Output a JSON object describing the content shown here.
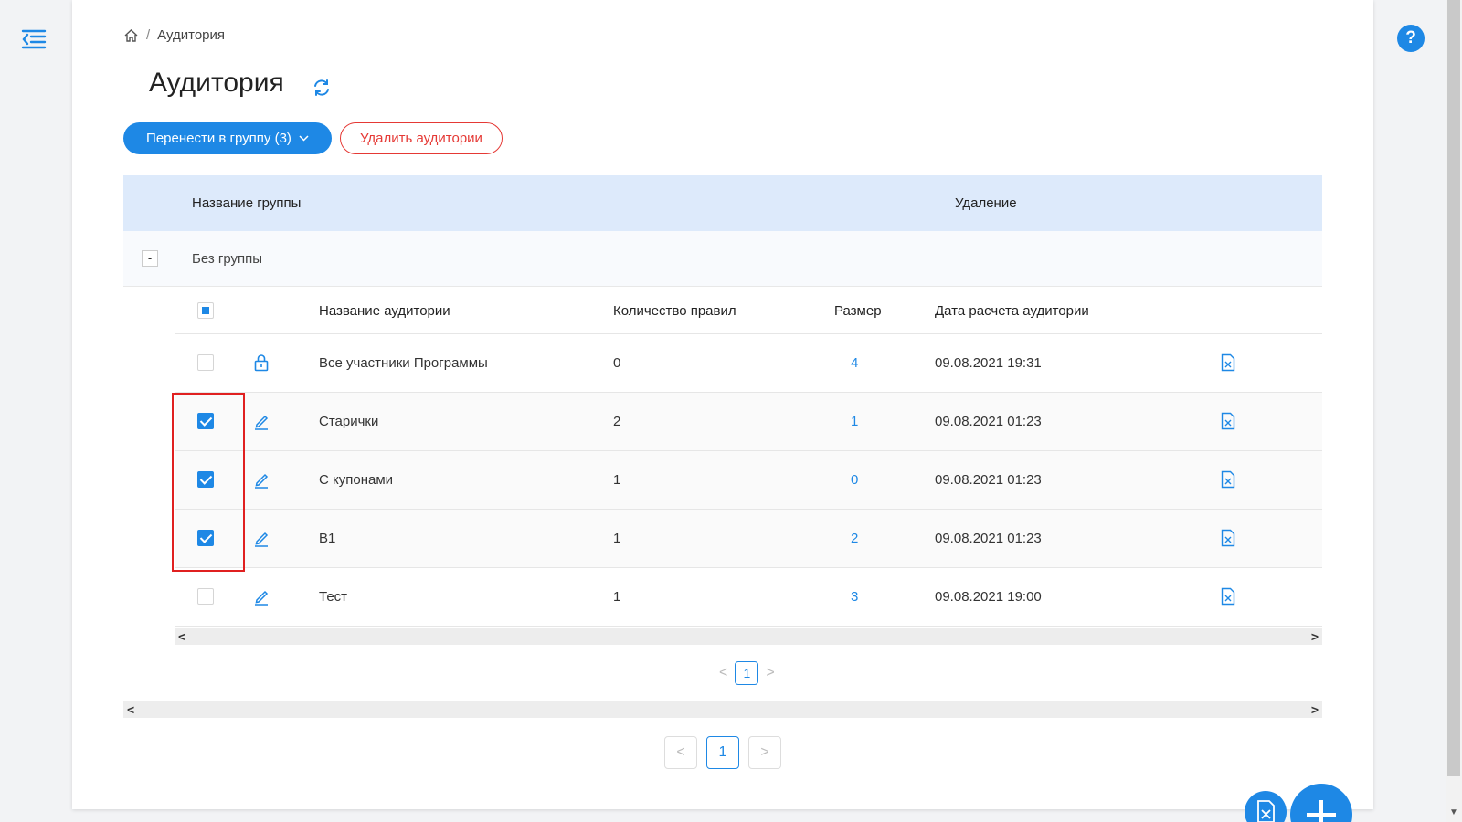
{
  "breadcrumb": {
    "current": "Аудитория",
    "separator": "/"
  },
  "page": {
    "title": "Аудитория"
  },
  "toolbar": {
    "move_label": "Перенести в группу (3)",
    "delete_label": "Удалить аудитории"
  },
  "group_table": {
    "col_group_name": "Название группы",
    "col_delete": "Удаление",
    "group_label": "Без группы",
    "collapse_symbol": "-"
  },
  "audience_table": {
    "headers": {
      "name": "Название аудитории",
      "rules": "Количество правил",
      "size": "Размер",
      "date": "Дата расчета аудитории"
    },
    "rows": [
      {
        "name": "Все участники Программы",
        "rules": "0",
        "size": "4",
        "date": "09.08.2021 19:31",
        "checked": false,
        "icon": "lock-icon"
      },
      {
        "name": "Старички",
        "rules": "2",
        "size": "1",
        "date": "09.08.2021 01:23",
        "checked": true,
        "icon": "edit-icon"
      },
      {
        "name": "С купонами",
        "rules": "1",
        "size": "0",
        "date": "09.08.2021 01:23",
        "checked": true,
        "icon": "edit-icon"
      },
      {
        "name": "В1",
        "rules": "1",
        "size": "2",
        "date": "09.08.2021 01:23",
        "checked": true,
        "icon": "edit-icon"
      },
      {
        "name": "Тест",
        "rules": "1",
        "size": "3",
        "date": "09.08.2021 19:00",
        "checked": false,
        "icon": "edit-icon"
      }
    ]
  },
  "pagination_inner": {
    "page": "1",
    "prev": "<",
    "next": ">"
  },
  "pagination_outer": {
    "page": "1",
    "prev": "<",
    "next": ">"
  },
  "scroll": {
    "left": "<",
    "right": ">"
  },
  "help": {
    "label": "?"
  },
  "colors": {
    "accent": "#1e88e5",
    "danger": "#e53935",
    "header_bg": "#ddeafb",
    "highlight": "#e02020"
  }
}
